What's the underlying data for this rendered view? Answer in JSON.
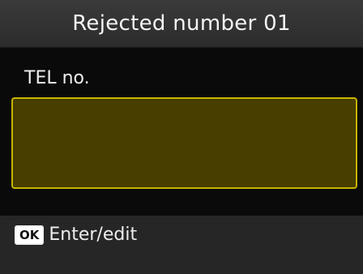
{
  "header": {
    "title": "Rejected number 01"
  },
  "form": {
    "field_label": "TEL no.",
    "field_value": ""
  },
  "footer": {
    "ok_key": "OK",
    "ok_action": "Enter/edit"
  },
  "colors": {
    "field_fill": "#473e00",
    "field_border": "#c7b400",
    "title_bar": "#333333",
    "footer_bar": "#262626"
  }
}
